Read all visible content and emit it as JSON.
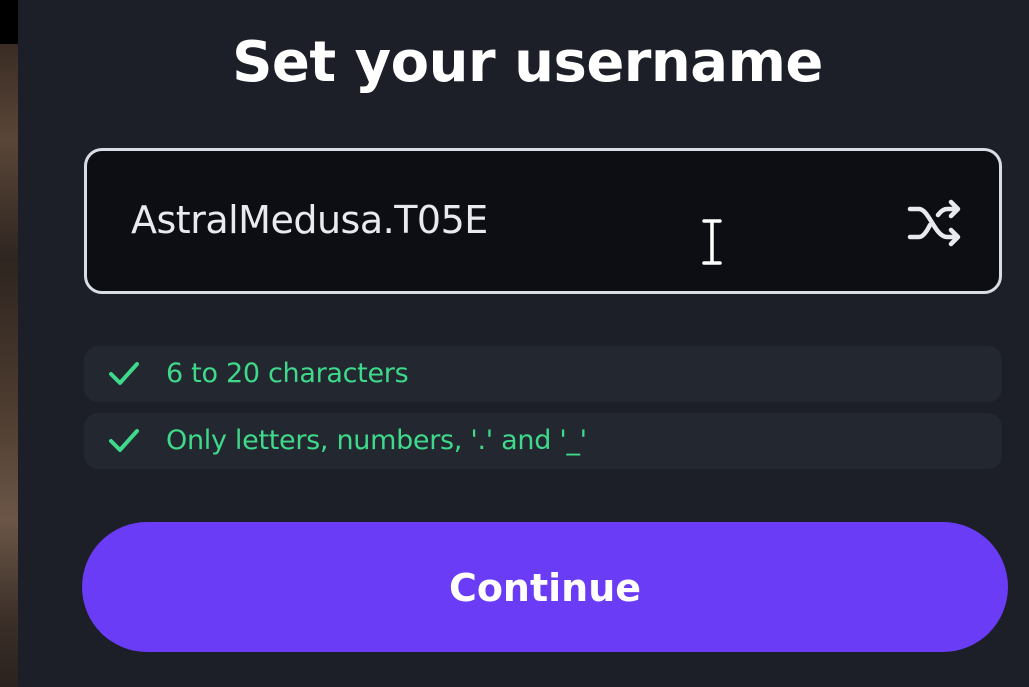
{
  "title": "Set your username",
  "username_input": {
    "value": "AstralMedusa.T05E"
  },
  "shuffle_icon": "shuffle-icon",
  "rules": [
    {
      "icon": "check-icon",
      "text": "6 to 20 characters",
      "status": "satisfied"
    },
    {
      "icon": "check-icon",
      "text": "Only letters, numbers, '.' and '_'",
      "status": "satisfied"
    }
  ],
  "continue_label": "Continue",
  "colors": {
    "background": "#1c1f27",
    "input_background": "#0d0e13",
    "input_border": "#d8dce4",
    "rule_background": "#232730",
    "rule_success": "#3ed98a",
    "accent": "#6b3cf6",
    "text": "#ffffff"
  }
}
